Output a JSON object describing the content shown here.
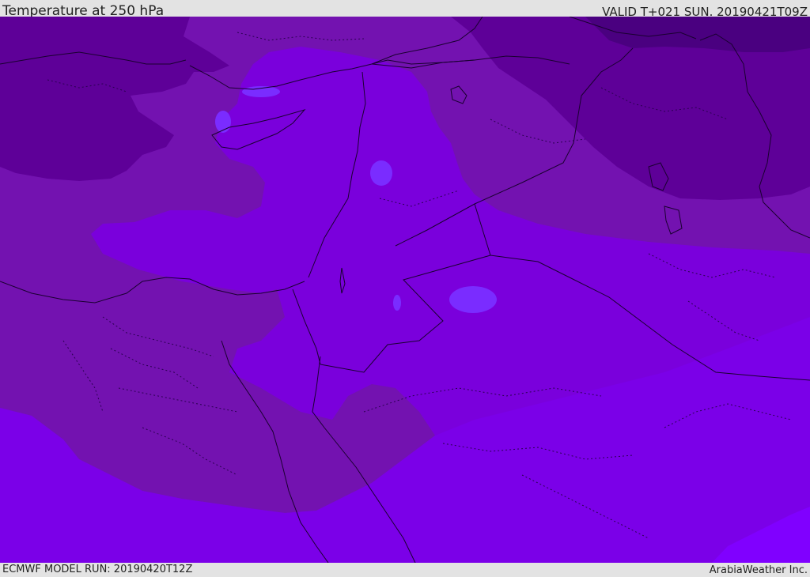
{
  "header": {
    "title": "Temperature at 250 hPa",
    "valid": "VALID T+021 SUN. 20190421T09Z"
  },
  "footer": {
    "model_run": "ECMWF MODEL RUN: 20190420T12Z",
    "credit": "ArabiaWeather Inc."
  },
  "map": {
    "shading_colors": {
      "darkest": "#4a0080",
      "dark": "#5e0098",
      "medium": "#7312b0",
      "light": "#7a00dc",
      "lighter": "#7b00e8",
      "lightest": "#8000ff",
      "spot": "#7a2cff"
    },
    "border_color": "#1a0030"
  }
}
